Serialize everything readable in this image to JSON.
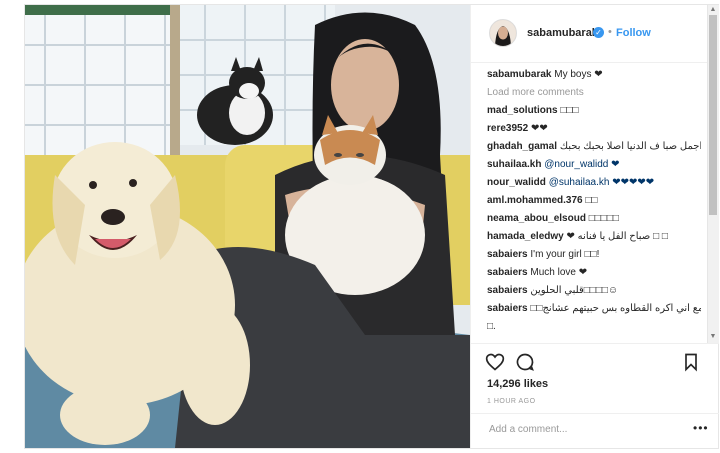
{
  "post": {
    "username": "sabamubarak",
    "follow_label": "Follow",
    "dot": "•",
    "verified_mark": "✓",
    "likes": "14,296 likes",
    "time": "1 HOUR AGO",
    "add_comment_placeholder": "Add a comment...",
    "more_options": "•••"
  },
  "caption": {
    "user": "sabamubarak",
    "text": "My boys ❤"
  },
  "load_more": "Load more comments",
  "comments": [
    {
      "user": "mad_solutions",
      "text": "□□□"
    },
    {
      "user": "rere3952",
      "text": "❤❤"
    },
    {
      "user": "ghadah_gamal",
      "text": "اجمل صبا ف الدنيا اصلا بحبك بحبك"
    },
    {
      "user": "suhailaa.kh",
      "text": "@nour_walidd ❤"
    },
    {
      "user": "nour_walidd",
      "text": "@suhailaa.kh ❤❤❤❤❤"
    },
    {
      "user": "aml.mohammed.376",
      "text": "□□"
    },
    {
      "user": "neama_abou_elsoud",
      "text": "□□□□□"
    },
    {
      "user": "hamada_eledwy",
      "text": "❤ صباح الفل يا فنانه □ □"
    },
    {
      "user": "sabaiers",
      "text": "I'm your girl □□!"
    },
    {
      "user": "sabaiers",
      "text": "Much love ❤"
    },
    {
      "user": "sabaiers",
      "text": "قلبي الحلوين□□□□☺"
    },
    {
      "user": "sabaiers",
      "text": "□□مع اني اكره القطاوه بس حبيتهم عشانج"
    },
    {
      "user": "",
      "text": "□."
    }
  ],
  "colors": {
    "link": "#3897f0",
    "border": "#efefef",
    "muted": "#999999"
  }
}
